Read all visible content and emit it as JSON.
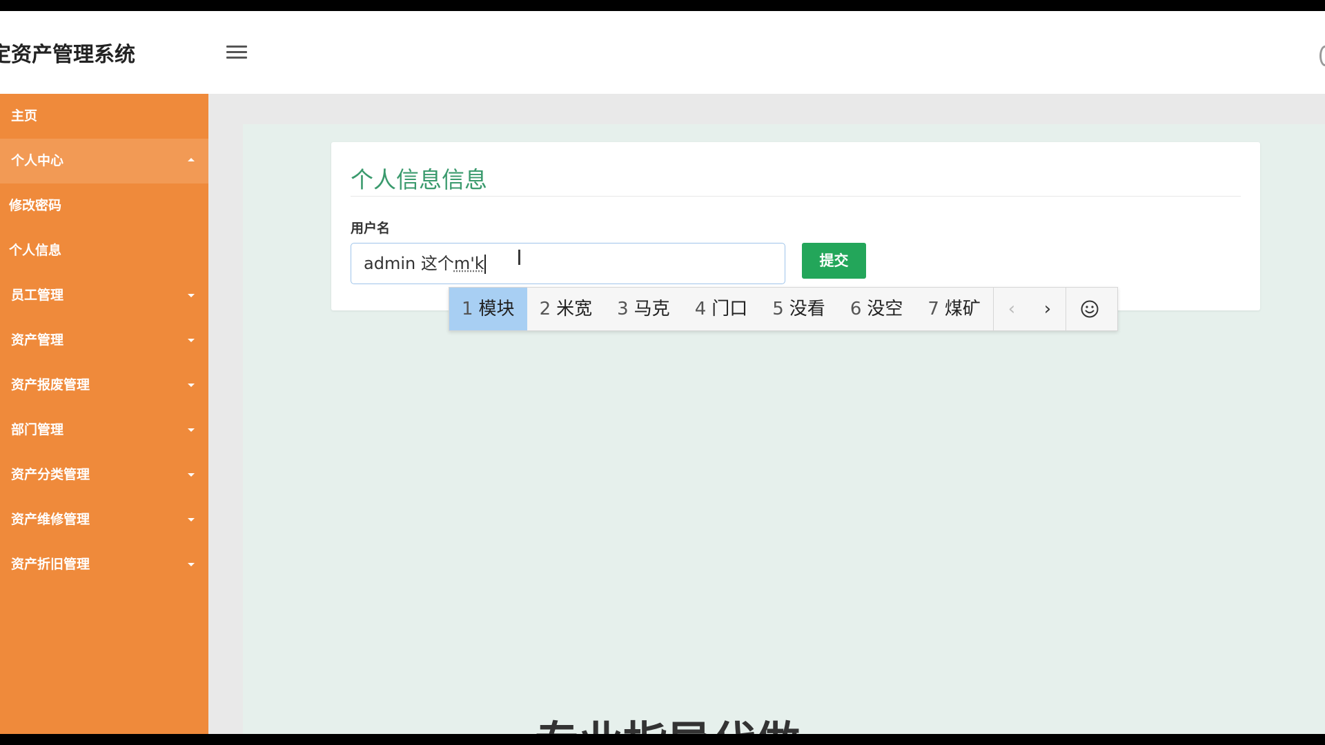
{
  "header": {
    "app_title": "定资产管理系统",
    "menu_toggle_icon": "hamburger-icon"
  },
  "sidebar": {
    "items": [
      {
        "label": "主页"
      },
      {
        "label": "个人中心",
        "caret": "up"
      },
      {
        "label": "修改密码",
        "sub": true
      },
      {
        "label": "个人信息",
        "sub": true
      },
      {
        "label": "员工管理",
        "caret": "down"
      },
      {
        "label": "资产管理",
        "caret": "down"
      },
      {
        "label": "资产报废管理",
        "caret": "down"
      },
      {
        "label": "部门管理",
        "caret": "down"
      },
      {
        "label": "资产分类管理",
        "caret": "down"
      },
      {
        "label": "资产维修管理",
        "caret": "down"
      },
      {
        "label": "资产折旧管理",
        "caret": "down"
      }
    ]
  },
  "form": {
    "title": "个人信息信息",
    "username_label": "用户名",
    "username_value": "admin 这个",
    "username_composition": "m'k",
    "submit_label": "提交"
  },
  "ime": {
    "candidates": [
      {
        "num": "1",
        "text": "模块",
        "selected": true
      },
      {
        "num": "2",
        "text": "米宽"
      },
      {
        "num": "3",
        "text": "马克"
      },
      {
        "num": "4",
        "text": "门口"
      },
      {
        "num": "5",
        "text": "没看"
      },
      {
        "num": "6",
        "text": "没空"
      },
      {
        "num": "7",
        "text": "煤矿"
      }
    ],
    "prev_icon": "‹",
    "next_icon": "›",
    "emoji_icon": "smiley-icon"
  },
  "overlay": {
    "bottom_text": "专业指导代做"
  },
  "colors": {
    "sidebar": "#ef8a3b",
    "accent_green": "#3a9a6d",
    "submit_green": "#23a65a",
    "content_bg": "#e6f0ec",
    "ime_selected": "#a8cff3"
  }
}
